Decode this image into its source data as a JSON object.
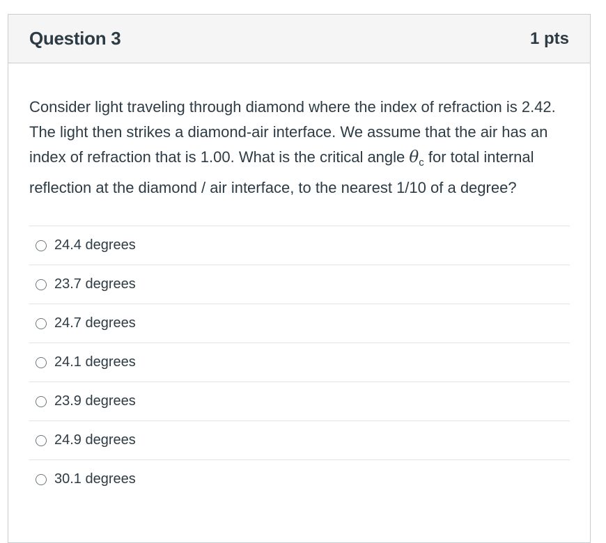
{
  "question": {
    "title": "Question 3",
    "points": "1 pts",
    "text_part1": "Consider light traveling through diamond where the index of refraction is 2.42.  The light then strikes a diamond-air interface.  We assume that the air has an index of refraction that is 1.00. What is the critical angle ",
    "theta_symbol": "θ",
    "theta_subscript": "c",
    "text_part2": " for total internal reflection at the diamond / air interface, to the nearest 1/10 of a degree?",
    "answers": [
      {
        "label": "24.4 degrees"
      },
      {
        "label": "23.7 degrees"
      },
      {
        "label": "24.7 degrees"
      },
      {
        "label": "24.1 degrees"
      },
      {
        "label": "23.9 degrees"
      },
      {
        "label": "24.9 degrees"
      },
      {
        "label": "30.1 degrees"
      }
    ]
  }
}
